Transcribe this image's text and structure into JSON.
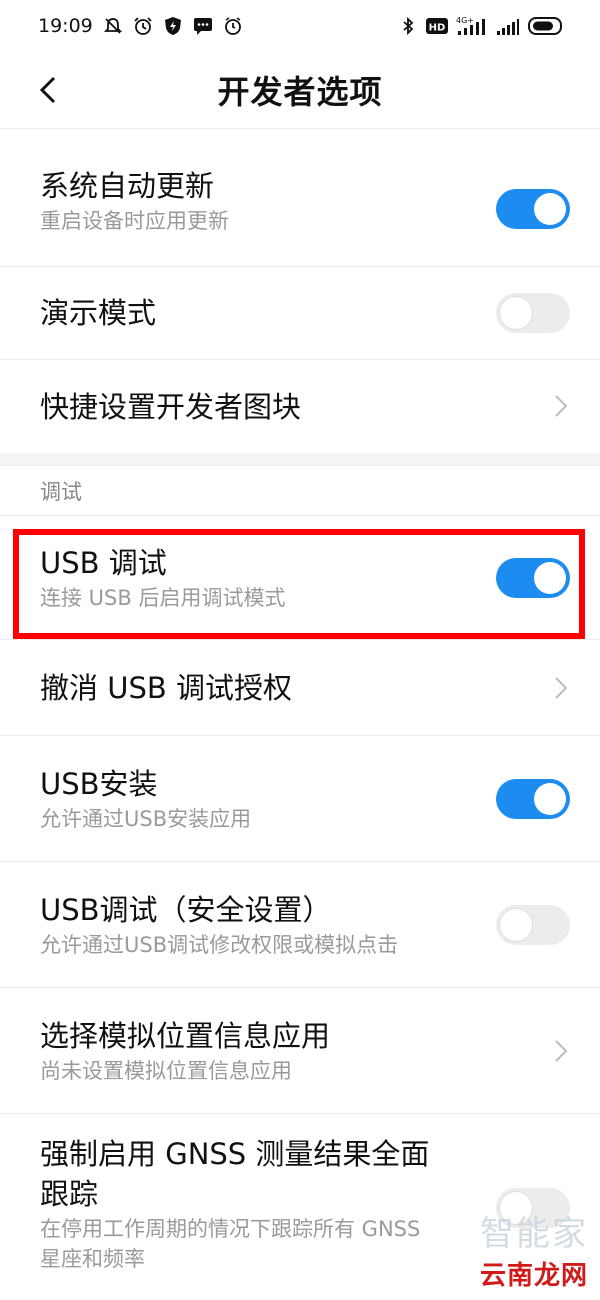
{
  "status_bar": {
    "time": "19:09",
    "left_icons": [
      "silent-notification-icon",
      "alarm-icon",
      "shield-icon",
      "message-icon",
      "clock-icon"
    ],
    "right_icons": [
      "bluetooth-icon",
      "hd-icon",
      "signal-4g-icon",
      "signal-icon",
      "battery-icon"
    ],
    "hd_label": "HD",
    "network_label": "4G+"
  },
  "header": {
    "title": "开发者选项"
  },
  "items_top": [
    {
      "title": "系统自动更新",
      "subtitle": "重启设备时应用更新",
      "control": "toggle",
      "on": true
    },
    {
      "title": "演示模式",
      "control": "toggle",
      "on": false
    },
    {
      "title": "快捷设置开发者图块",
      "control": "chevron"
    }
  ],
  "section": {
    "title": "调试"
  },
  "items_debug": [
    {
      "title": "USB 调试",
      "subtitle": "连接 USB 后启用调试模式",
      "control": "toggle",
      "on": true
    },
    {
      "title": "撤消 USB 调试授权",
      "control": "chevron"
    },
    {
      "title": "USB安装",
      "subtitle": "允许通过USB安装应用",
      "control": "toggle",
      "on": true
    },
    {
      "title": "USB调试（安全设置）",
      "subtitle": "允许通过USB调试修改权限或模拟点击",
      "control": "toggle",
      "on": false
    },
    {
      "title": "选择模拟位置信息应用",
      "subtitle": "尚未设置模拟位置信息应用",
      "control": "chevron"
    },
    {
      "title": "强制启用 GNSS 测量结果全面跟踪",
      "subtitle": "在停用工作周期的情况下跟踪所有 GNSS 星座和频率",
      "control": "toggle",
      "on": false
    }
  ],
  "colors": {
    "accent": "#1c8cf0",
    "highlight": "#ff0000",
    "toggle_off": "#ececec"
  },
  "watermark": {
    "top": "智能家",
    "bottom": "云南龙网"
  }
}
